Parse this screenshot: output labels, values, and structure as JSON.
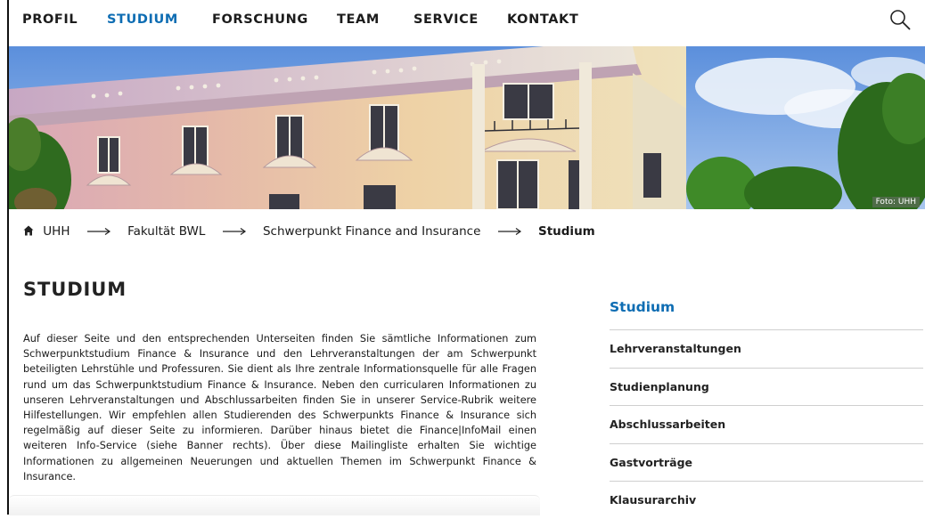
{
  "nav": {
    "items": [
      {
        "label": "PROFIL",
        "active": false
      },
      {
        "label": "STUDIUM",
        "active": true
      },
      {
        "label": "FORSCHUNG",
        "active": false
      },
      {
        "label": "TEAM",
        "active": false
      },
      {
        "label": "SERVICE",
        "active": false
      },
      {
        "label": "KONTAKT",
        "active": false
      }
    ],
    "search_icon": "search-icon"
  },
  "hero": {
    "photo_credit": "Foto: UHH"
  },
  "breadcrumb": {
    "home_icon": "home-icon",
    "items": [
      "UHH",
      "Fakultät BWL",
      "Schwerpunkt Finance and Insurance",
      "Studium"
    ]
  },
  "main": {
    "title": "STUDIUM",
    "intro": "Auf dieser Seite und den entsprechenden Unterseiten finden Sie sämtliche Informationen zum Schwerpunktstudium Finance & Insurance und den Lehrveranstaltungen der am Schwerpunkt beteiligten Lehrstühle und Professuren. Sie dient als Ihre zentrale Informationsquelle für alle Fragen rund um das Schwerpunktstudium Finance & Insurance. Neben den curricularen Informationen zu unseren Lehrveranstaltungen und Abschlussarbeiten finden Sie in unserer Service-Rubrik weitere Hilfestellungen. Wir empfehlen allen Studierenden des Schwerpunkts Finance & Insurance sich regelmäßig auf dieser Seite zu informieren. Darüber hinaus bietet die Finance|InfoMail einen weiteren Info-Service (siehe Banner rechts). Über diese Mailingliste erhalten Sie wichtige Informationen zu allgemeinen Neuerungen und aktuellen Themen im Schwerpunkt Finance & Insurance."
  },
  "sidenav": {
    "title": "Studium",
    "items": [
      "Lehrveranstaltungen",
      "Studienplanung",
      "Abschlussarbeiten",
      "Gastvorträge",
      "Klausurarchiv"
    ]
  },
  "colors": {
    "accent": "#0e6db3",
    "text": "#1a1a1a"
  }
}
